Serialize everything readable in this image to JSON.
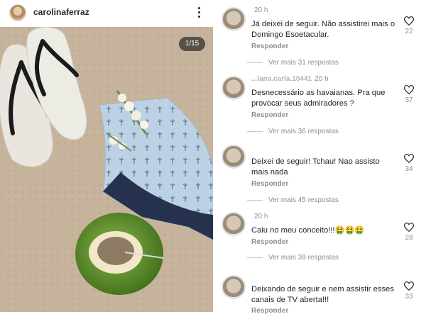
{
  "post": {
    "username": "carolinaferraz",
    "page_indicator": "1/15",
    "more_icon": "more-vertical-icon"
  },
  "comments": [
    {
      "username": "",
      "time": "20 h",
      "text": "Já deixei de seguir. Não assistirei mais o Domingo Esoetacular.",
      "reply": "Responder",
      "likes": "22",
      "more_replies": "Ver mais 31 respostas"
    },
    {
      "username": "...lana.carla.10441",
      "time": "20 h",
      "text": "Desnecessário as havaianas. Pra que provocar seus admiradores ?",
      "reply": "Responder",
      "likes": "37",
      "more_replies": "Ver mais 36 respostas"
    },
    {
      "username": "",
      "time": "",
      "text": "Deixei de seguir! Tchau! Nao assisto mais nada",
      "reply": "Responder",
      "likes": "34",
      "more_replies": "Ver mais 45 respostas"
    },
    {
      "username": "",
      "time": "20 h",
      "text": "Caiu no meu conceito!!!🤮🤮🤮",
      "reply": "Responder",
      "likes": "28",
      "more_replies": "Ver mais 39 respostas"
    },
    {
      "username": "",
      "time": "",
      "text": "Deixando de seguir e nem assistir esses canais de TV aberta!!!",
      "reply": "Responder",
      "likes": "33",
      "more_replies": ""
    }
  ],
  "colors": {
    "muted": "#8e8e8e",
    "text": "#262626",
    "accent": "#0095f6"
  }
}
